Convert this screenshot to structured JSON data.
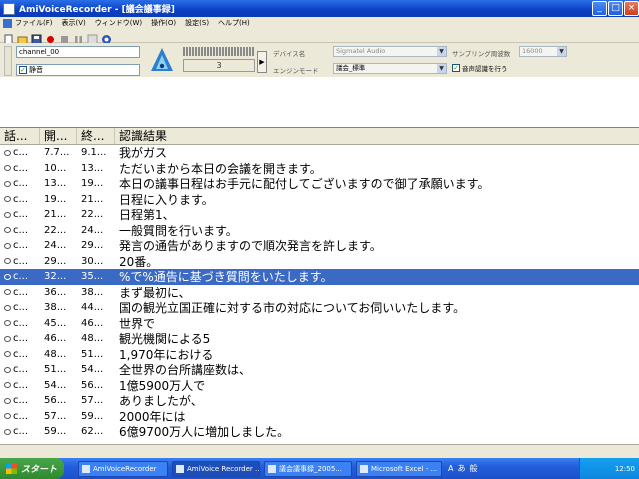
{
  "window": {
    "title": "AmiVoiceRecorder - [議会議事録]",
    "min": "_",
    "max": "□",
    "close": "×"
  },
  "menu": [
    "ファイル(F)",
    "表示(V)",
    "ウィンドウ(W)",
    "操作(O)",
    "設定(S)",
    "ヘルプ(H)"
  ],
  "toolbar": {
    "icons": [
      "new-file-icon",
      "open-folder-icon",
      "save-icon",
      "record-icon",
      "stop-icon",
      "pause-icon",
      "play-icon",
      "help-icon"
    ],
    "colors": {
      "record": "#d80000"
    }
  },
  "panel": {
    "channel": "channel_00",
    "mute_label": "静音",
    "mute_checked": true,
    "meter_value": "3",
    "play_symbol": "▶",
    "device_label": "デバイス名",
    "device_value": "Sigmatel Audio",
    "engine_label": "エンジンモード",
    "engine_value": "議会_標準",
    "sampling_label": "サンプリング周波数",
    "sampling_value": "16000",
    "realtime_label": "音声認識を行う",
    "realtime_checked": true
  },
  "list": {
    "columns": [
      "話...",
      "開...",
      "終...",
      "認識結果"
    ],
    "selected_index": 8,
    "rows": [
      {
        "ch": "c...",
        "start": "7.7...",
        "end": "9.1...",
        "text": "我がガス"
      },
      {
        "ch": "c...",
        "start": "10...",
        "end": "13...",
        "text": "ただいまから本日の会議を開きます。"
      },
      {
        "ch": "c...",
        "start": "13...",
        "end": "19...",
        "text": "本日の議事日程はお手元に配付してございますので御了承願います。"
      },
      {
        "ch": "c...",
        "start": "19...",
        "end": "21...",
        "text": "日程に入ります。"
      },
      {
        "ch": "c...",
        "start": "21...",
        "end": "22...",
        "text": "日程第1、"
      },
      {
        "ch": "c...",
        "start": "22...",
        "end": "24...",
        "text": "一般質問を行います。"
      },
      {
        "ch": "c...",
        "start": "24...",
        "end": "29...",
        "text": "発言の通告がありますので順次発言を許します。"
      },
      {
        "ch": "c...",
        "start": "29...",
        "end": "30...",
        "text": "20番。"
      },
      {
        "ch": "c...",
        "start": "32...",
        "end": "35...",
        "text": "%で%通告に基づき質問をいたします。"
      },
      {
        "ch": "c...",
        "start": "36...",
        "end": "38...",
        "text": "まず最初に、"
      },
      {
        "ch": "c...",
        "start": "38...",
        "end": "44...",
        "text": "国の観光立国正確に対する市の対応についてお伺いいたします。"
      },
      {
        "ch": "c...",
        "start": "45...",
        "end": "46...",
        "text": "世界で"
      },
      {
        "ch": "c...",
        "start": "46...",
        "end": "48...",
        "text": "観光機関による5"
      },
      {
        "ch": "c...",
        "start": "48...",
        "end": "51...",
        "text": "1,970年における"
      },
      {
        "ch": "c...",
        "start": "51...",
        "end": "54...",
        "text": "全世界の台所講座数は、"
      },
      {
        "ch": "c...",
        "start": "54...",
        "end": "56...",
        "text": "1億5900万人で"
      },
      {
        "ch": "c...",
        "start": "56...",
        "end": "57...",
        "text": "ありましたが、"
      },
      {
        "ch": "c...",
        "start": "57...",
        "end": "59...",
        "text": "2000年には"
      },
      {
        "ch": "c...",
        "start": "59...",
        "end": "62...",
        "text": "6億9700万人に増加しました。"
      }
    ]
  },
  "taskbar": {
    "start": "スタート",
    "tasks": [
      "AmiVoiceRecorder",
      "AmiVoice Recorder ...",
      "議会議事録_2005...",
      "Microsoft Excel - ..."
    ],
    "ime": [
      "A",
      "あ",
      "般"
    ],
    "clock": "12:50"
  }
}
